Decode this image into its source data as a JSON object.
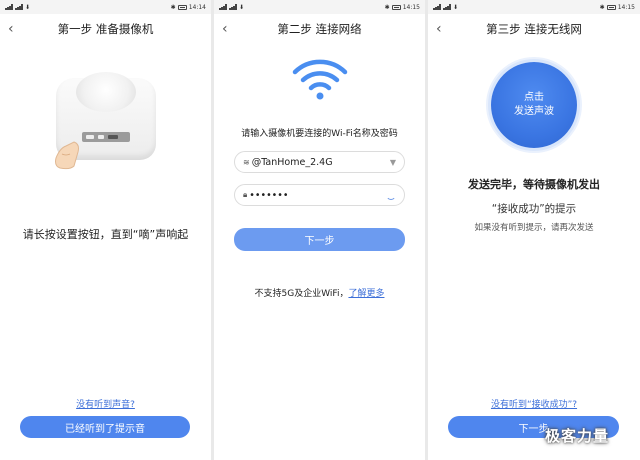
{
  "status_bars": [
    {
      "time": "14:14"
    },
    {
      "time": "14:15"
    },
    {
      "time": "14:15"
    }
  ],
  "screen1": {
    "title": "第一步 准备摄像机",
    "instruction": "请长按设置按钮，直到“嘀”声响起",
    "link": "没有听到声音?",
    "button": "已经听到了提示音"
  },
  "screen2": {
    "title": "第二步 连接网络",
    "instruction": "请输入摄像机要连接的Wi-Fi名称及密码",
    "ssid": "@TanHome_2.4G",
    "password": "•••••••",
    "button": "下一步",
    "note": "不支持5G及企业WiFi，",
    "note_link": "了解更多"
  },
  "screen3": {
    "title": "第三步 连接无线网",
    "circle_line1": "点击",
    "circle_line2": "发送声波",
    "status": "发送完毕，等待摄像机发出",
    "status2": "“接收成功”的提示",
    "hint": "如果没有听到提示，请再次发送",
    "link": "没有听到“接收成功”?",
    "button": "下一步"
  },
  "watermark": "极客力量",
  "colors": {
    "accent": "#4f86ee",
    "link": "#3d6fd8",
    "wifi": "#4a8ef0"
  },
  "icons": [
    "back-arrow-icon",
    "wifi-icon",
    "lock-icon",
    "dropdown-icon",
    "spinner-icon"
  ]
}
